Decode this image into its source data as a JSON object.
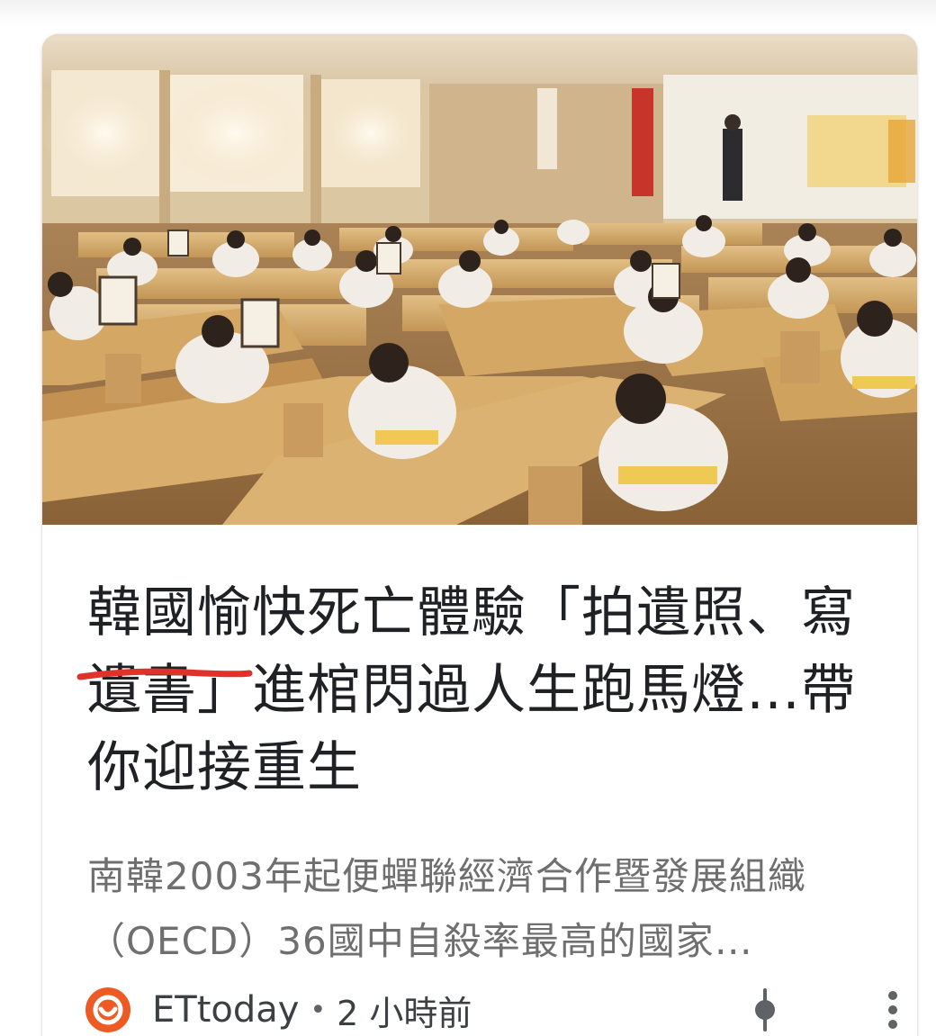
{
  "article": {
    "image_alt": "Participants in white robes sitting at wooden coffins writing letters, with portrait photos beside them",
    "title": "韓國愉快死亡體驗「拍遺照、寫遺書」進棺閃過人生跑馬燈…帶你迎接重生",
    "snippet": "南韓2003年起便蟬聯經濟合作暨發展組織（OECD）36國中自殺率最高的國家…",
    "source": "ETtoday",
    "separator": "•",
    "time": "2 小時前"
  },
  "colors": {
    "source_logo": "#ee5a24",
    "underline_annotation": "#e0322b",
    "title_text": "#202124",
    "snippet_text": "#6f6f6f"
  },
  "icons": {
    "source_logo": "ettoday-logo-icon",
    "sort": "slider-icon",
    "more": "more-vertical-icon"
  }
}
